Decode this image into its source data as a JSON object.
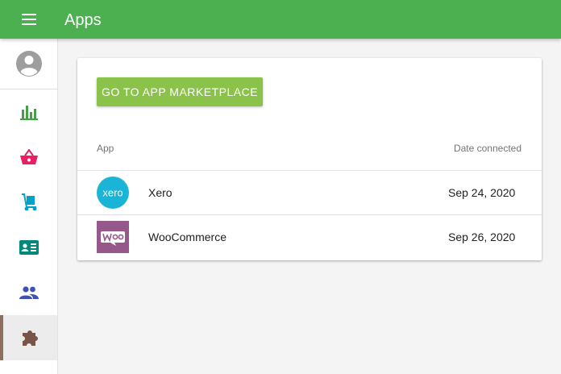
{
  "header": {
    "title": "Apps",
    "color": "#4caf50",
    "menu_icon": "menu-icon"
  },
  "sidebar": {
    "avatar_icon": "account-circle-icon",
    "items": [
      {
        "name": "reports",
        "icon": "bar-chart-icon",
        "color": "#43a047",
        "active": false
      },
      {
        "name": "sales",
        "icon": "basket-icon",
        "color": "#e91e63",
        "active": false
      },
      {
        "name": "delivery",
        "icon": "hand-truck-icon",
        "color": "#00a2c7",
        "active": false
      },
      {
        "name": "contacts",
        "icon": "contact-card-icon",
        "color": "#00897b",
        "active": false
      },
      {
        "name": "users",
        "icon": "people-icon",
        "color": "#3f51b5",
        "active": false
      },
      {
        "name": "apps",
        "icon": "puzzle-icon",
        "color": "#795548",
        "active": true
      }
    ]
  },
  "main": {
    "marketplace_button": "GO TO APP MARKETPLACE",
    "table": {
      "columns": [
        "App",
        "Date connected"
      ],
      "rows": [
        {
          "app": "Xero",
          "date": "Sep 24, 2020",
          "logo_icon": "xero-logo-icon",
          "logo_color": "#1ab4d7"
        },
        {
          "app": "WooCommerce",
          "date": "Sep 26, 2020",
          "logo_icon": "woocommerce-logo-icon",
          "logo_color": "#96588a"
        }
      ]
    }
  }
}
